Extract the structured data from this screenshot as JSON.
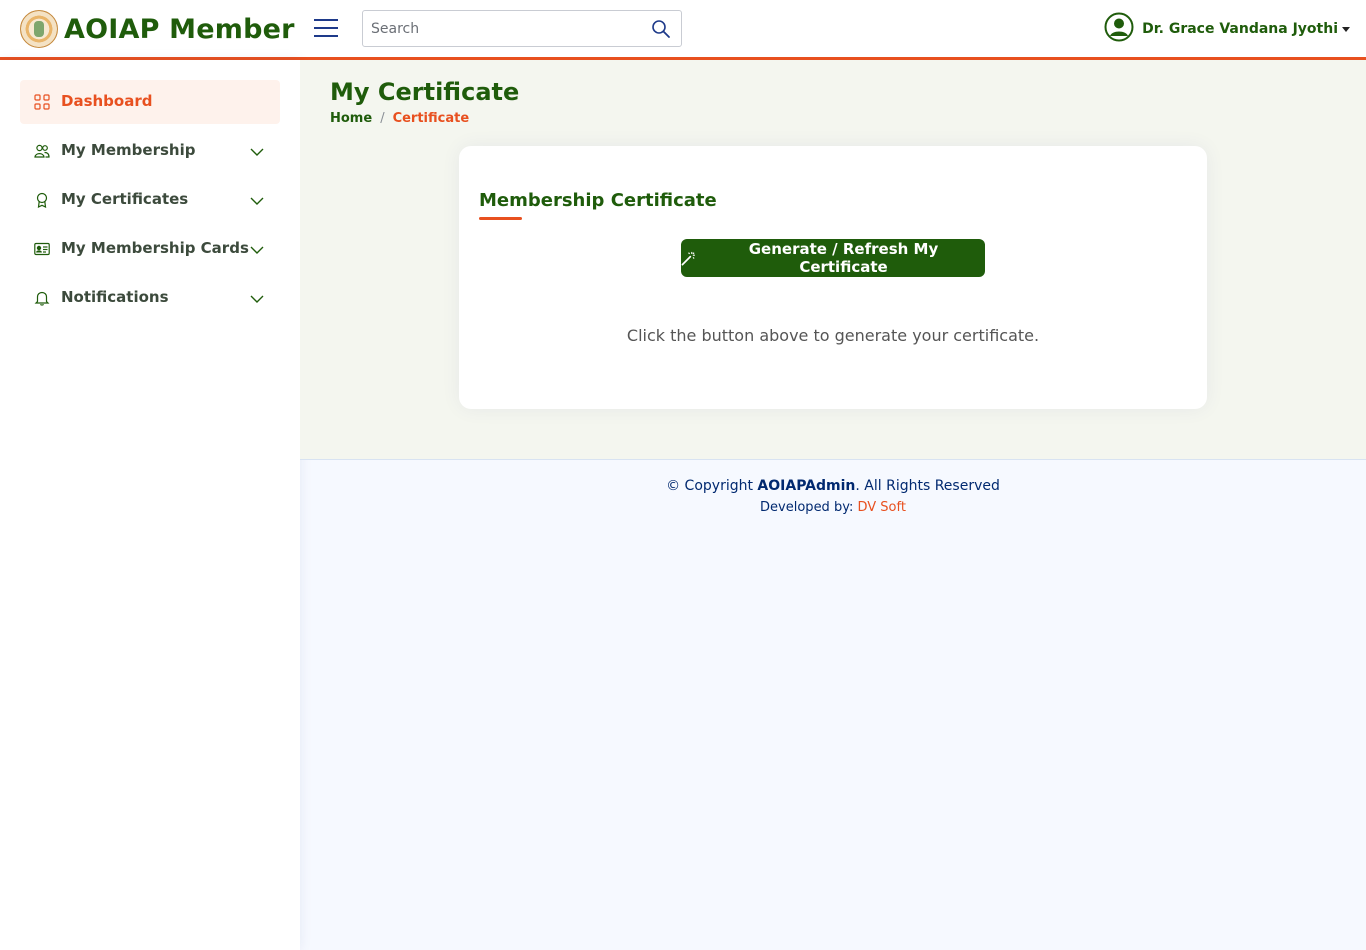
{
  "header": {
    "app_title": "AOIAP Member",
    "search_placeholder": "Search",
    "user_name": "Dr. Grace Vandana Jyothi"
  },
  "sidebar": {
    "items": [
      {
        "label": "Dashboard",
        "icon": "grid-icon",
        "active": true
      },
      {
        "label": "My Membership",
        "icon": "people-icon"
      },
      {
        "label": "My Certificates",
        "icon": "award-icon"
      },
      {
        "label": "My Membership Cards",
        "icon": "id-card-icon"
      },
      {
        "label": "Notifications",
        "icon": "bell-icon"
      }
    ]
  },
  "page": {
    "title": "My Certificate",
    "breadcrumb": {
      "home": "Home",
      "separator": "/",
      "current": "Certificate"
    }
  },
  "card": {
    "title": "Membership Certificate",
    "button_label": "Generate / Refresh My Certificate",
    "hint": "Click the button above to generate your certificate."
  },
  "footer": {
    "copyright_prefix": "© Copyright",
    "brand": "AOIAPAdmin",
    "copyright_suffix": ". All Rights Reserved",
    "developed_by": "Developed by:",
    "developer": "DV Soft"
  },
  "colors": {
    "brand_green": "#1f5c0b",
    "accent_orange": "#e8501f",
    "footer_text": "#012970"
  }
}
